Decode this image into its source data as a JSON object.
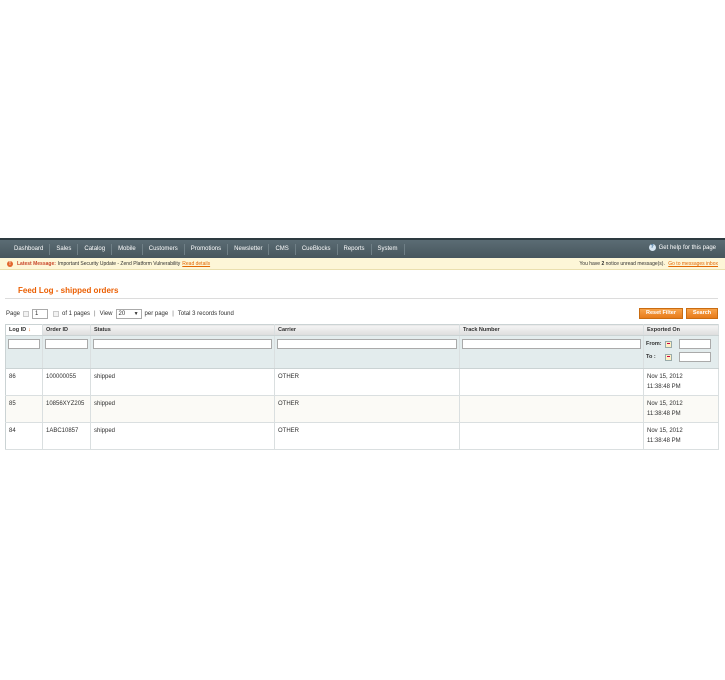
{
  "nav": {
    "items": [
      "Dashboard",
      "Sales",
      "Catalog",
      "Mobile",
      "Customers",
      "Promotions",
      "Newsletter",
      "CMS",
      "CueBlocks",
      "Reports",
      "System"
    ],
    "help_label": "Get help for this page"
  },
  "message": {
    "label": "Latest Message:",
    "text": "Important Security Update - Zend Platform Vulnerability",
    "link": "Read details",
    "right_prefix": "You have",
    "unread_count": "2",
    "right_suffix": "notice unread message(s).",
    "right_link": "Go to messages inbox"
  },
  "page_title": "Feed Log - shipped orders",
  "pager": {
    "page_label": "Page",
    "page_value": "1",
    "of_pages": "of 1 pages",
    "view_label": "View",
    "view_value": "20",
    "per_page": "per page",
    "records": "Total 3 records found"
  },
  "buttons": {
    "reset": "Reset Filter",
    "search": "Search"
  },
  "grid": {
    "columns": [
      "Log ID",
      "Order ID",
      "Status",
      "Carrier",
      "Track Number",
      "Exported On"
    ],
    "sort_arrow": "↓",
    "from_label": "From:",
    "to_label": "To :",
    "rows": [
      {
        "log_id": "86",
        "order_id": "100000055",
        "status": "shipped",
        "carrier": "OTHER",
        "track": "",
        "date": "Nov 15, 2012",
        "time": "11:38:48 PM"
      },
      {
        "log_id": "85",
        "order_id": "10856XYZ205",
        "status": "shipped",
        "carrier": "OTHER",
        "track": "",
        "date": "Nov 15, 2012",
        "time": "11:38:48 PM"
      },
      {
        "log_id": "84",
        "order_id": "1ABC10857",
        "status": "shipped",
        "carrier": "OTHER",
        "track": "",
        "date": "Nov 15, 2012",
        "time": "11:38:48 PM"
      }
    ]
  },
  "colors": {
    "accent": "#eb5e00",
    "nav_bg": "#4f5f66",
    "message_bg": "#fdf6d7"
  }
}
